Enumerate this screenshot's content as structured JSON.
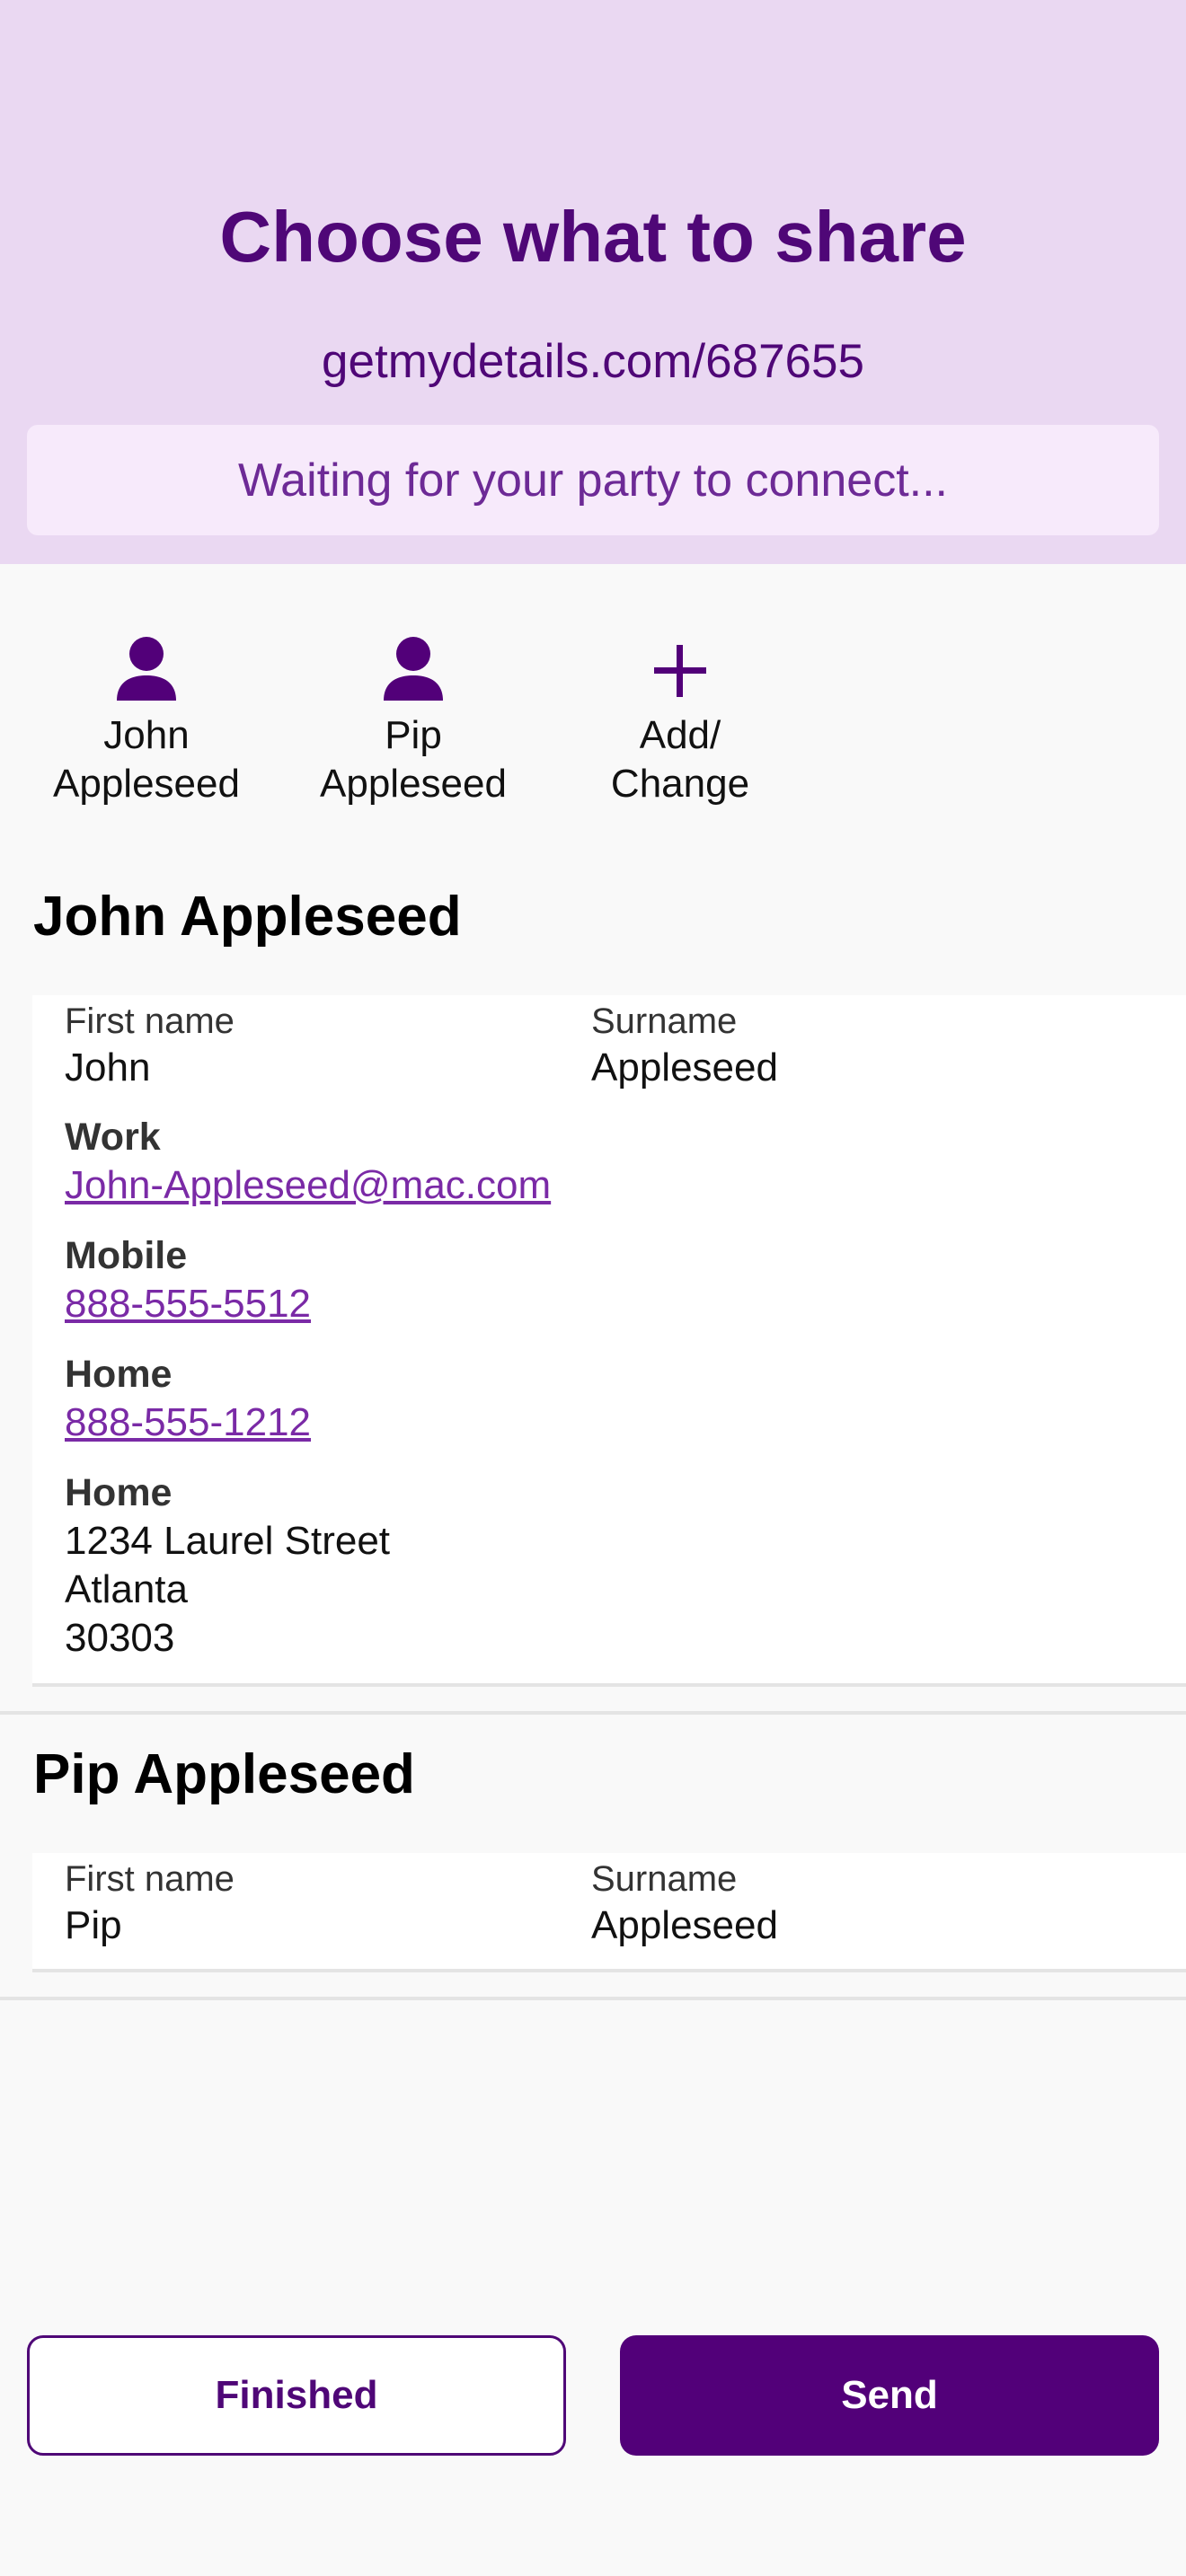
{
  "header": {
    "title": "Choose what to share",
    "url": "getmydetails.com/687655",
    "status": "Waiting for your party to connect..."
  },
  "contacts": [
    {
      "label_line1": "John",
      "label_line2": "Appleseed",
      "icon": "person-icon"
    },
    {
      "label_line1": "Pip",
      "label_line2": "Appleseed",
      "icon": "person-icon"
    },
    {
      "label_line1": "Add/",
      "label_line2": "Change",
      "icon": "plus-icon"
    }
  ],
  "john": {
    "title": "John Appleseed",
    "first_name_label": "First name",
    "first_name": "John",
    "surname_label": "Surname",
    "surname": "Appleseed",
    "email_label": "Work",
    "email": "John-Appleseed@mac.com",
    "mobile_label": "Mobile",
    "mobile": "888-555-5512",
    "home_phone_label": "Home",
    "home_phone": "888-555-1212",
    "address_label": "Home",
    "address_street": "1234 Laurel Street",
    "address_city": "Atlanta",
    "address_zip": "30303"
  },
  "pip": {
    "title": "Pip Appleseed",
    "first_name_label": "First name",
    "first_name": "Pip",
    "surname_label": "Surname",
    "surname": "Appleseed"
  },
  "buttons": {
    "finished": "Finished",
    "send": "Send"
  },
  "colors": {
    "brand": "#4f0777",
    "header_bg": "#ead8f2",
    "status_bg": "#f7eafb",
    "link": "#7a2aa6"
  }
}
